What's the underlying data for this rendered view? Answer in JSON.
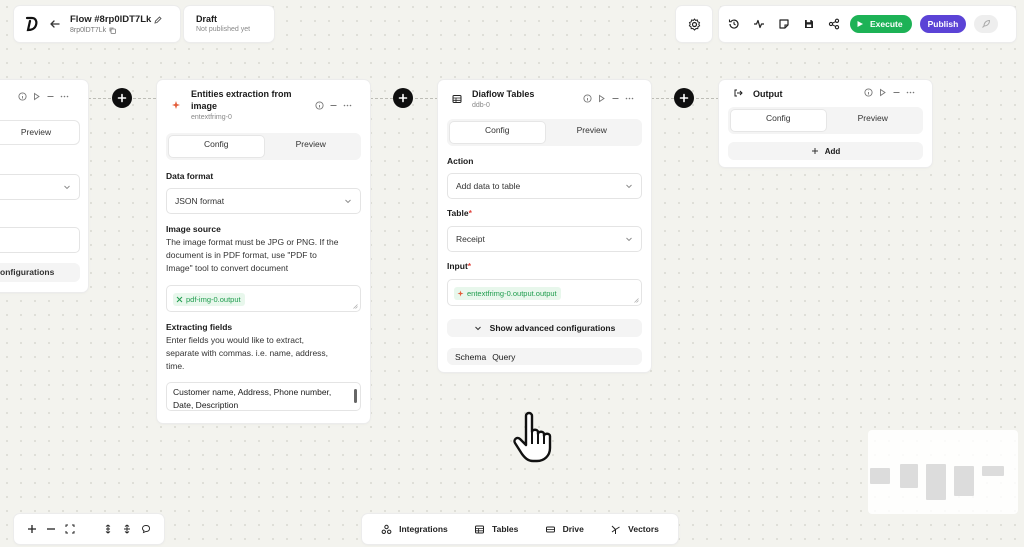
{
  "header": {
    "flow_title": "Flow #8rp0lDT7Lk",
    "flow_id": "8rp0lDT7Lk",
    "status_title": "Draft",
    "status_sub": "Not published yet"
  },
  "toolbar": {
    "execute_label": "Execute",
    "publish_label": "Publish"
  },
  "colors": {
    "execute": "#1db256",
    "publish": "#5b43d6",
    "chip_text": "#1f9d4e"
  },
  "nodes": {
    "left": {
      "preview_tab": "Preview",
      "configs_button": "onfigurations"
    },
    "entities": {
      "title_line1": "Entities extraction from",
      "title_line2": "image",
      "id": "entextfrimg-0",
      "tab_config": "Config",
      "tab_preview": "Preview",
      "data_format_label": "Data format",
      "data_format_value": "JSON format",
      "image_source_label": "Image source",
      "image_source_help_1": "The image format must be JPG or PNG. If the",
      "image_source_help_2": "document is in PDF format, use \"PDF to",
      "image_source_help_3": "Image\" tool to convert document",
      "image_source_chip": "pdf-img-0.output",
      "extract_label": "Extracting fields",
      "extract_help_1": "Enter fields you would like to extract,",
      "extract_help_2": "separate with commas. i.e. name, address,",
      "extract_help_3": "time.",
      "extract_value_1": "Customer name, Address, Phone number,",
      "extract_value_2": "Date, Description"
    },
    "tables": {
      "title": "Diaflow Tables",
      "id": "ddb-0",
      "tab_config": "Config",
      "tab_preview": "Preview",
      "action_label": "Action",
      "action_value": "Add data to table",
      "table_label": "Table",
      "table_value": "Receipt",
      "input_label": "Input",
      "required_mark": "*",
      "input_chip": "entextfrimg-0.output.output",
      "advanced_label": "Show advanced configurations",
      "schema_tab": "Schema",
      "query_tab": "Query"
    },
    "output": {
      "title": "Output",
      "tab_config": "Config",
      "tab_preview": "Preview",
      "add_label": "Add"
    }
  },
  "bottom_bar": {
    "integrations": "Integrations",
    "tables": "Tables",
    "drive": "Drive",
    "vectors": "Vectors"
  }
}
